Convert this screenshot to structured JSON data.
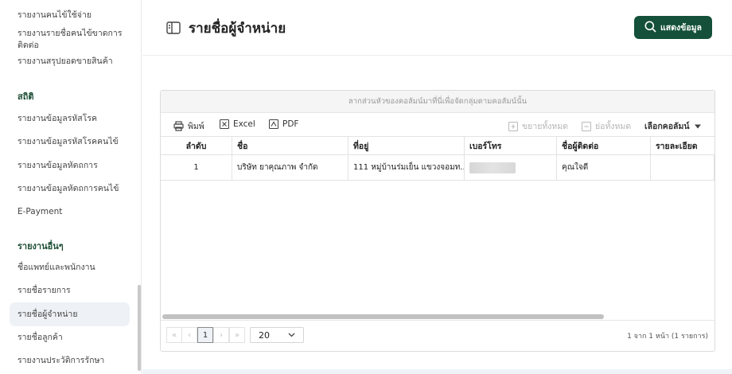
{
  "sidebar": {
    "top_items": [
      "รายงานคนไข้ใช้จ่าย",
      "รายงานรายชื่อคนไข้ขาดการติดต่อ",
      "รายงานสรุปยอดขายสินค้า"
    ],
    "section_stats": {
      "title": "สถิติ",
      "items": [
        "รายงานข้อมูลรหัสโรค",
        "รายงานข้อมูลรหัสโรคคนไข้",
        "รายงานข้อมูลหัตถการ",
        "รายงานข้อมูลหัตถการคนไข้",
        "E-Payment"
      ]
    },
    "section_other": {
      "title": "รายงานอื่นๆ",
      "items": [
        "ชื่อแพทย์และพนักงาน",
        "รายชื่อรายการ",
        "รายชื่อผู้จำหน่าย",
        "รายชื่อลูกค้า",
        "รายงานประวัติการรักษา"
      ]
    }
  },
  "header": {
    "title": "รายชื่อผู้จำหน่าย",
    "show_button": "แสดงข้อมูล"
  },
  "grid": {
    "group_hint": "ลากส่วนหัวของคอลัมน์มาที่นี่เพื่อจัดกลุ่มตามคอลัมน์นั้น",
    "toolbar": {
      "print": "พิมพ์",
      "excel": "Excel",
      "pdf": "PDF",
      "expand_all": "ขยายทั้งหมด",
      "collapse_all": "ย่อทั้งหมด",
      "choose_columns": "เลือกคอลัมน์"
    },
    "columns": [
      "ลำดับ",
      "ชื่อ",
      "ที่อยู่",
      "เบอร์โทร",
      "ชื่อผู้ติดต่อ",
      "รายละเอียด"
    ],
    "rows": [
      {
        "no": "1",
        "name": "บริษัท ยาคุณภาพ จำกัด",
        "address": "111 หมู่บ้านร่มเย็น แขวงจอมท...",
        "phone": "",
        "contact": "คุณใจดี",
        "detail": ""
      }
    ],
    "pager": {
      "first": "«",
      "prev": "‹",
      "current": "1",
      "next": "›",
      "last": "»",
      "page_size": "20",
      "info": "1 จาก 1 หน้า (1 รายการ)"
    }
  },
  "colors": {
    "primary": "#14503a",
    "section_title": "#1e4f36",
    "active_bg": "#eef2f6"
  },
  "icons": [
    "book-icon",
    "search-icon",
    "printer-icon",
    "excel-icon",
    "pdf-icon",
    "expand-icon",
    "collapse-icon",
    "caret-down-icon",
    "chevron-down-icon"
  ]
}
